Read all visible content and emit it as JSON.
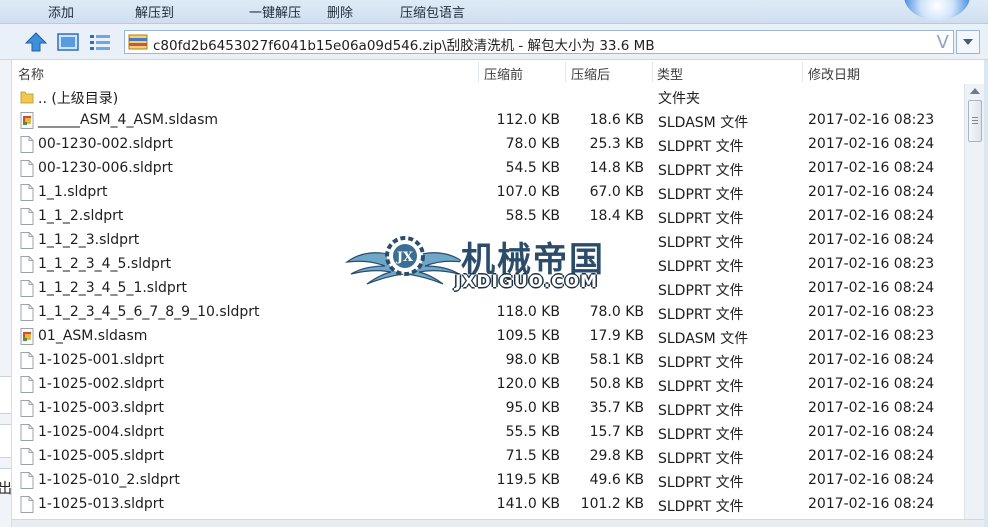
{
  "toolbar": {
    "items": [
      {
        "label": "添加"
      },
      {
        "label": "解压到"
      },
      {
        "label": "一键解压"
      },
      {
        "label": "删除"
      },
      {
        "label": "压缩包语言"
      }
    ]
  },
  "address": {
    "path": "c80fd2b6453027f6041b15e06a09d546.zip\\刮胶清洗机 - 解包大小为 33.6 MB",
    "v_glyph": "V"
  },
  "columns": {
    "name": "名称",
    "size": "压缩前",
    "packed": "压缩后",
    "type": "类型",
    "date": "修改日期"
  },
  "rows": [
    {
      "icon": "folder-up-icon",
      "name": ".. (上级目录)",
      "size": "",
      "packed": "",
      "type": "文件夹",
      "date": ""
    },
    {
      "icon": "assembly-file-icon",
      "name": "______ASM_4_ASM.sldasm",
      "size": "112.0 KB",
      "packed": "18.6 KB",
      "type": "SLDASM 文件",
      "date": "2017-02-16 08:23"
    },
    {
      "icon": "file-icon",
      "name": "00-1230-002.sldprt",
      "size": "78.0 KB",
      "packed": "25.3 KB",
      "type": "SLDPRT 文件",
      "date": "2017-02-16 08:24"
    },
    {
      "icon": "file-icon",
      "name": "00-1230-006.sldprt",
      "size": "54.5 KB",
      "packed": "14.8 KB",
      "type": "SLDPRT 文件",
      "date": "2017-02-16 08:24"
    },
    {
      "icon": "file-icon",
      "name": "1_1.sldprt",
      "size": "107.0 KB",
      "packed": "67.0 KB",
      "type": "SLDPRT 文件",
      "date": "2017-02-16 08:24"
    },
    {
      "icon": "file-icon",
      "name": "1_1_2.sldprt",
      "size": "58.5 KB",
      "packed": "18.4 KB",
      "type": "SLDPRT 文件",
      "date": "2017-02-16 08:24"
    },
    {
      "icon": "file-icon",
      "name": "1_1_2_3.sldprt",
      "size": "",
      "packed": "",
      "type": "SLDPRT 文件",
      "date": "2017-02-16 08:24"
    },
    {
      "icon": "file-icon",
      "name": "1_1_2_3_4_5.sldprt",
      "size": "",
      "packed": "",
      "type": "SLDPRT 文件",
      "date": "2017-02-16 08:23"
    },
    {
      "icon": "file-icon",
      "name": "1_1_2_3_4_5_1.sldprt",
      "size": "",
      "packed": "",
      "type": "SLDPRT 文件",
      "date": "2017-02-16 08:24"
    },
    {
      "icon": "file-icon",
      "name": "1_1_2_3_4_5_6_7_8_9_10.sldprt",
      "size": "118.0 KB",
      "packed": "78.0 KB",
      "type": "SLDPRT 文件",
      "date": "2017-02-16 08:23"
    },
    {
      "icon": "assembly-file-icon",
      "name": "01_ASM.sldasm",
      "size": "109.5 KB",
      "packed": "17.9 KB",
      "type": "SLDASM 文件",
      "date": "2017-02-16 08:23"
    },
    {
      "icon": "file-icon",
      "name": "1-1025-001.sldprt",
      "size": "98.0 KB",
      "packed": "58.1 KB",
      "type": "SLDPRT 文件",
      "date": "2017-02-16 08:24"
    },
    {
      "icon": "file-icon",
      "name": "1-1025-002.sldprt",
      "size": "120.0 KB",
      "packed": "50.8 KB",
      "type": "SLDPRT 文件",
      "date": "2017-02-16 08:24"
    },
    {
      "icon": "file-icon",
      "name": "1-1025-003.sldprt",
      "size": "95.0 KB",
      "packed": "35.7 KB",
      "type": "SLDPRT 文件",
      "date": "2017-02-16 08:24"
    },
    {
      "icon": "file-icon",
      "name": "1-1025-004.sldprt",
      "size": "55.5 KB",
      "packed": "15.7 KB",
      "type": "SLDPRT 文件",
      "date": "2017-02-16 08:24"
    },
    {
      "icon": "file-icon",
      "name": "1-1025-005.sldprt",
      "size": "71.5 KB",
      "packed": "29.8 KB",
      "type": "SLDPRT 文件",
      "date": "2017-02-16 08:24"
    },
    {
      "icon": "file-icon",
      "name": "1-1025-010_2.sldprt",
      "size": "119.5 KB",
      "packed": "49.6 KB",
      "type": "SLDPRT 文件",
      "date": "2017-02-16 08:24"
    },
    {
      "icon": "file-icon",
      "name": "1-1025-013.sldprt",
      "size": "141.0 KB",
      "packed": "101.2 KB",
      "type": "SLDPRT 文件",
      "date": "2017-02-16 08:24"
    }
  ],
  "watermark": {
    "title": "机械帝国",
    "site": "JXDIGUO.COM",
    "badge": "JX"
  },
  "left_strip": {
    "fragment": "出"
  },
  "colors": {
    "toolbar_bg": "#d6e4f4",
    "address_border": "#9db6d6",
    "folder": "#f2c94c",
    "watermark_dark": "#2b4d6b"
  }
}
